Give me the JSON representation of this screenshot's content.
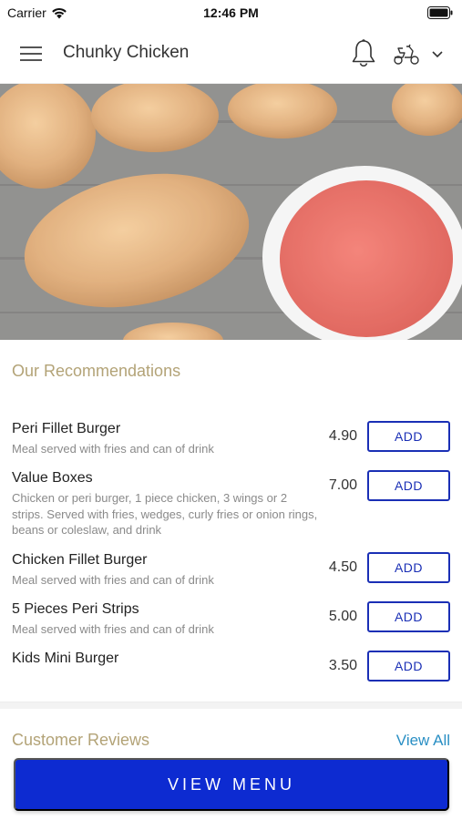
{
  "status_bar": {
    "carrier": "Carrier",
    "time": "12:46 PM"
  },
  "navbar": {
    "title": "Chunky Chicken"
  },
  "recommendations": {
    "title": "Our Recommendations",
    "add_label": "ADD",
    "items": [
      {
        "name": "Peri Fillet Burger",
        "desc": "Meal served with fries and can of drink",
        "price": "4.90"
      },
      {
        "name": "Value Boxes",
        "desc": "Chicken or peri burger, 1 piece chicken, 3 wings or 2 strips. Served with fries, wedges, curly fries or onion rings, beans or coleslaw, and drink",
        "price": "7.00"
      },
      {
        "name": "Chicken Fillet Burger",
        "desc": "Meal served with fries and can of drink",
        "price": "4.50"
      },
      {
        "name": "5 Pieces Peri Strips",
        "desc": "Meal served with fries and can of drink",
        "price": "5.00"
      },
      {
        "name": "Kids Mini Burger",
        "desc": "",
        "price": "3.50"
      }
    ]
  },
  "reviews": {
    "title": "Customer Reviews",
    "view_all": "View All"
  },
  "footer": {
    "view_menu": "VIEW MENU"
  },
  "colors": {
    "accent": "#0d2bd1",
    "section_title": "#b3a377",
    "link": "#2a8fc4"
  }
}
